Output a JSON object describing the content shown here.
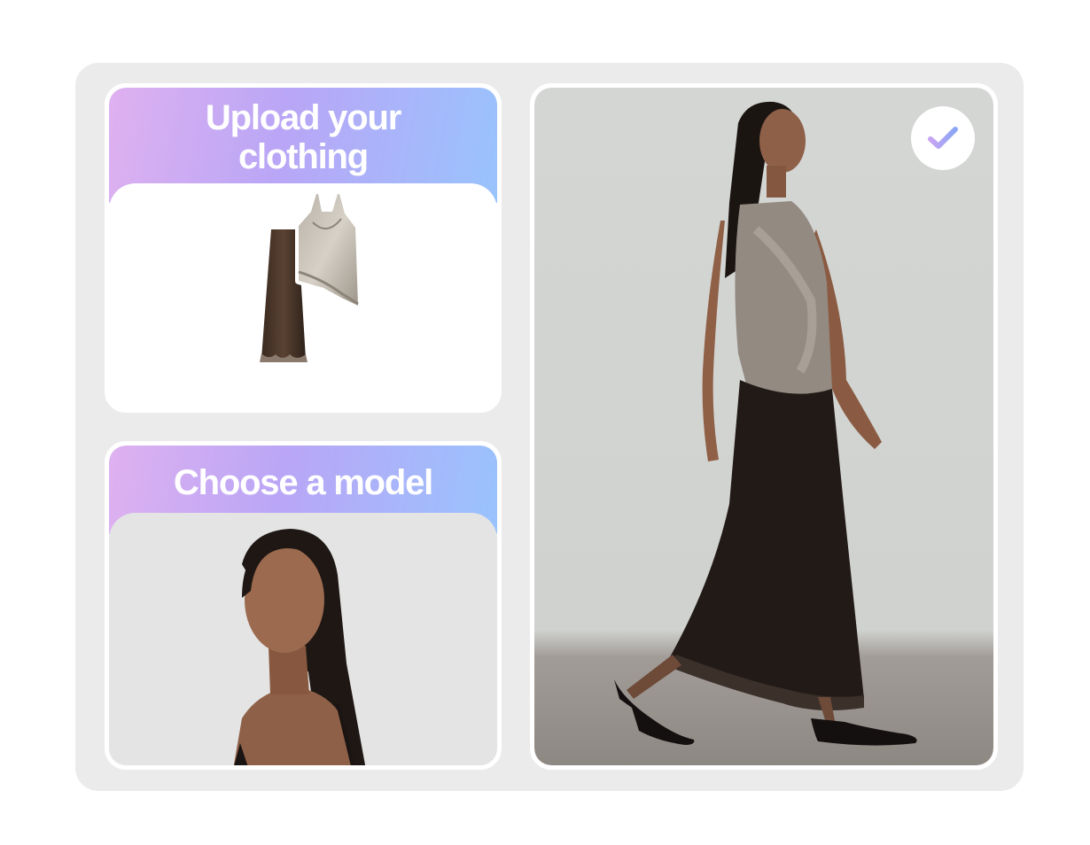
{
  "steps": {
    "upload": {
      "title_line1": "Upload your",
      "title_line2": "clothing"
    },
    "model": {
      "title": "Choose a model"
    }
  },
  "result": {
    "status_icon": "checkmark-icon"
  },
  "colors": {
    "gradient_start": "#dfb1f0",
    "gradient_mid": "#b9a6f6",
    "gradient_end": "#99c3fd",
    "stage_background": "#ebebeb",
    "card_background": "#ffffff"
  }
}
